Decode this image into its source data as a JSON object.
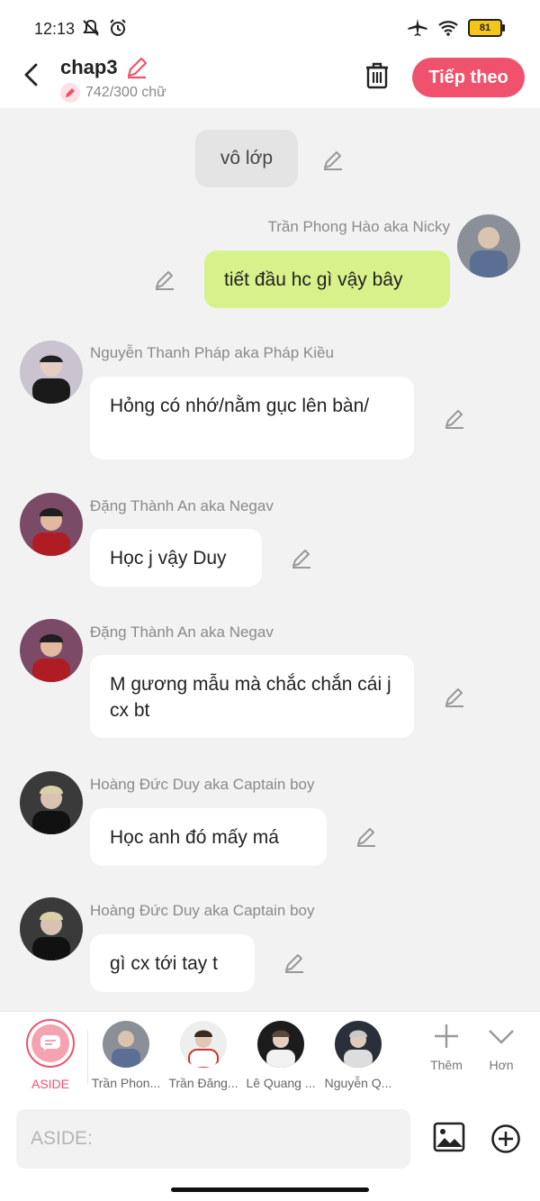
{
  "status": {
    "time": "12:13",
    "battery": "81"
  },
  "header": {
    "title": "chap3",
    "word_count": "742/300 chữ",
    "next_label": "Tiếp theo"
  },
  "narration": {
    "text": "vô lớp"
  },
  "messages": [
    {
      "name": "Trần Phong Hào aka Nicky",
      "text": "tiết đầu hc gì vậy bây"
    },
    {
      "name": "Nguyễn Thanh Pháp aka Pháp Kiều",
      "text": "Hỏng có nhớ/nằm gục lên bàn/"
    },
    {
      "name": "Đặng Thành An aka Negav",
      "text": "Học j vậy Duy"
    },
    {
      "name": "Đặng Thành An aka Negav",
      "text": "M gương mẫu mà chắc chắn cái j cx bt"
    },
    {
      "name": "Hoàng Đức Duy aka Captain boy",
      "text": "Học anh đó mấy má"
    },
    {
      "name": "Hoàng Đức Duy aka Captain boy",
      "text": "gì cx tới tay t"
    }
  ],
  "bottom_bar": {
    "aside_label": "ASIDE",
    "characters": [
      "Trần Phon...",
      "Trần Đăng...",
      "Lê Quang ...",
      "Nguyễn Q..."
    ],
    "more_label": "Thêm",
    "expand_label": "Hơn"
  },
  "input": {
    "placeholder": "ASIDE:"
  },
  "colors": {
    "accent": "#f0526d",
    "my_bubble": "#d8f28b",
    "background": "#f2f2f2"
  }
}
